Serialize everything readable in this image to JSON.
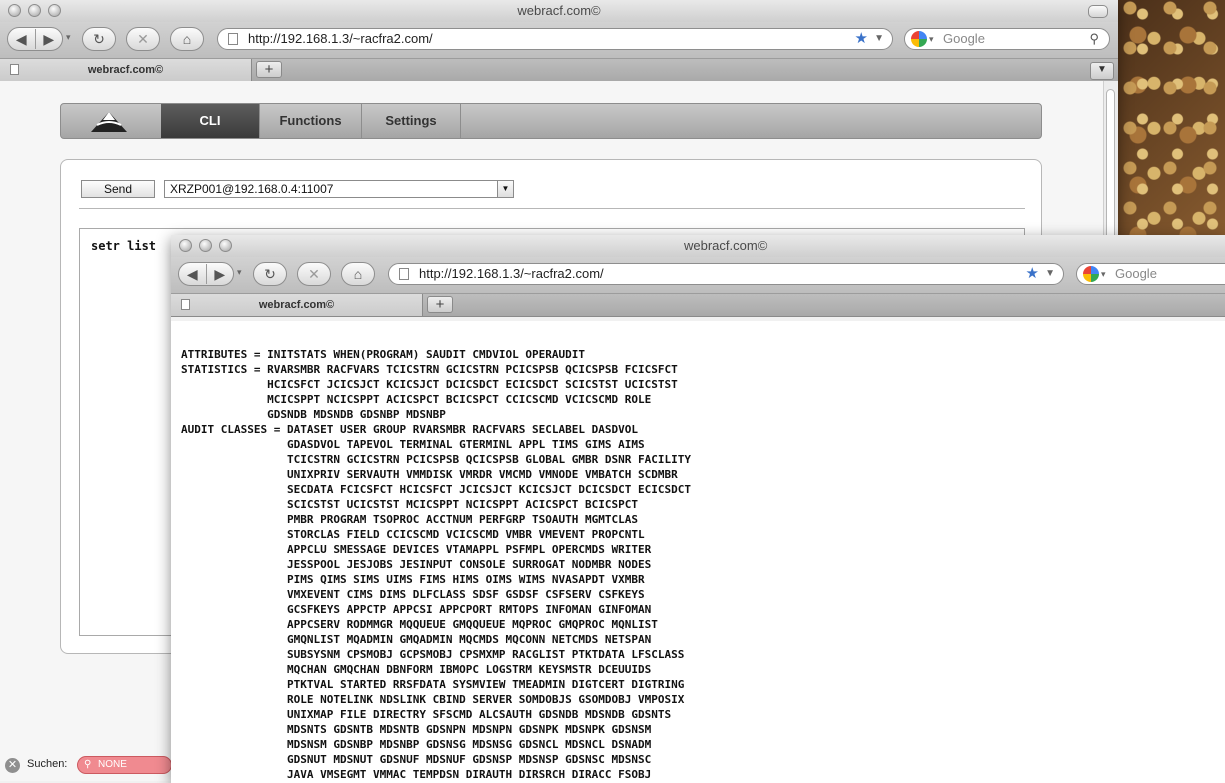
{
  "main_window": {
    "title": "webracf.com©",
    "url": "http://192.168.1.3/~racfra2.com/",
    "search_placeholder": "Google",
    "tab_title": "webracf.com©"
  },
  "app": {
    "nav": [
      {
        "label": "CLI",
        "active": true
      },
      {
        "label": "Functions",
        "active": false
      },
      {
        "label": "Settings",
        "active": false
      }
    ],
    "send_label": "Send",
    "host_value": "XRZP001@192.168.0.4:11007",
    "command": "setr list"
  },
  "status_bar": {
    "label": "Suchen:",
    "field_value": "NONE"
  },
  "popup_window": {
    "title": "webracf.com©",
    "url": "http://192.168.1.3/~racfra2.com/",
    "search_placeholder": "Google",
    "tab_title": "webracf.com©",
    "output_lines": [
      "ATTRIBUTES = INITSTATS WHEN(PROGRAM) SAUDIT CMDVIOL OPERAUDIT",
      "STATISTICS = RVARSMBR RACFVARS TCICSTRN GCICSTRN PCICSPSB QCICSPSB FCICSFCT",
      "             HCICSFCT JCICSJCT KCICSJCT DCICSDCT ECICSDCT SCICSTST UCICSTST",
      "             MCICSPPT NCICSPPT ACICSPCT BCICSPCT CCICSCMD VCICSCMD ROLE",
      "             GDSNDB MDSNDB GDSNBP MDSNBP",
      "AUDIT CLASSES = DATASET USER GROUP RVARSMBR RACFVARS SECLABEL DASDVOL",
      "                GDASDVOL TAPEVOL TERMINAL GTERMINL APPL TIMS GIMS AIMS",
      "                TCICSTRN GCICSTRN PCICSPSB QCICSPSB GLOBAL GMBR DSNR FACILITY",
      "                UNIXPRIV SERVAUTH VMMDISK VMRDR VMCMD VMNODE VMBATCH SCDMBR",
      "                SECDATA FCICSFCT HCICSFCT JCICSJCT KCICSJCT DCICSDCT ECICSDCT",
      "                SCICSTST UCICSTST MCICSPPT NCICSPPT ACICSPCT BCICSPCT",
      "                PMBR PROGRAM TSOPROC ACCTNUM PERFGRP TSOAUTH MGMTCLAS",
      "                STORCLAS FIELD CCICSCMD VCICSCMD VMBR VMEVENT PROPCNTL",
      "                APPCLU SMESSAGE DEVICES VTAMAPPL PSFMPL OPERCMDS WRITER",
      "                JESSPOOL JESJOBS JESINPUT CONSOLE SURROGAT NODMBR NODES",
      "                PIMS QIMS SIMS UIMS FIMS HIMS OIMS WIMS NVASAPDT VXMBR",
      "                VMXEVENT CIMS DIMS DLFCLASS SDSF GSDSF CSFSERV CSFKEYS",
      "                GCSFKEYS APPCTP APPCSI APPCPORT RMTOPS INFOMAN GINFOMAN",
      "                APPCSERV RODMMGR MQQUEUE GMQQUEUE MQPROC GMQPROC MQNLIST",
      "                GMQNLIST MQADMIN GMQADMIN MQCMDS MQCONN NETCMDS NETSPAN",
      "                SUBSYSNM CPSMOBJ GCPSMOBJ CPSMXMP RACGLIST PTKTDATA LFSCLASS",
      "                MQCHAN GMQCHAN DBNFORM IBMOPC LOGSTRM KEYSMSTR DCEUUIDS",
      "                PTKTVAL STARTED RRSFDATA SYSMVIEW TMEADMIN DIGTCERT DIGTRING",
      "                ROLE NOTELINK NDSLINK CBIND SERVER SOMDOBJS GSOMDOBJ VMPOSIX",
      "                UNIXMAP FILE DIRECTRY SFSCMD ALCSAUTH GDSNDB MDSNDB GDSNTS",
      "                MDSNTS GDSNTB MDSNTB GDSNPN MDSNPN GDSNPK MDSNPK GDSNSM",
      "                MDSNSM GDSNBP MDSNBP GDSNSG MDSNSG GDSNCL MDSNCL DSNADM",
      "                GDSNUT MDSNUT GDSNUF MDSNUF GDSNSP MDSNSP GDSNSC MDSNSC",
      "                JAVA VMSEGMT VMMAC TEMPDSN DIRAUTH DIRSRCH DIRACC FSOBJ"
    ]
  },
  "colors": {
    "nav_active": "#3a3a3a",
    "url_star": "#3a72c9",
    "status_field": "#f08a90"
  }
}
